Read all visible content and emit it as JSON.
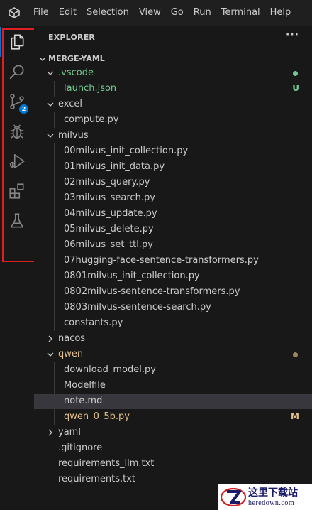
{
  "menu": [
    "File",
    "Edit",
    "Selection",
    "View",
    "Go",
    "Run",
    "Terminal",
    "Help"
  ],
  "activity_bar": {
    "items": [
      {
        "name": "explorer",
        "icon": "files-icon",
        "active": true
      },
      {
        "name": "search",
        "icon": "search-icon"
      },
      {
        "name": "source-control",
        "icon": "source-control-icon",
        "badge": "2"
      },
      {
        "name": "run-debug",
        "icon": "bug-icon"
      },
      {
        "name": "run",
        "icon": "run-debug-icon"
      },
      {
        "name": "extensions",
        "icon": "extensions-icon"
      },
      {
        "name": "testing",
        "icon": "flask-icon"
      }
    ]
  },
  "explorer": {
    "title": "EXPLORER",
    "more": "···",
    "folder": "MERGE-YAML"
  },
  "tree": [
    {
      "label": ".vscode",
      "type": "folder",
      "open": true,
      "depth": 0,
      "color": "green",
      "dot": "#73c991"
    },
    {
      "label": "launch.json",
      "type": "file",
      "depth": 1,
      "color": "green",
      "status": "U"
    },
    {
      "label": "excel",
      "type": "folder",
      "open": true,
      "depth": 0
    },
    {
      "label": "compute.py",
      "type": "file",
      "depth": 1
    },
    {
      "label": "milvus",
      "type": "folder",
      "open": true,
      "depth": 0
    },
    {
      "label": "00milvus_init_collection.py",
      "type": "file",
      "depth": 1
    },
    {
      "label": "01milvus_init_data.py",
      "type": "file",
      "depth": 1
    },
    {
      "label": "02milvus_query.py",
      "type": "file",
      "depth": 1
    },
    {
      "label": "03milvus_search.py",
      "type": "file",
      "depth": 1
    },
    {
      "label": "04milvus_update.py",
      "type": "file",
      "depth": 1
    },
    {
      "label": "05milvus_delete.py",
      "type": "file",
      "depth": 1
    },
    {
      "label": "06milvus_set_ttl.py",
      "type": "file",
      "depth": 1
    },
    {
      "label": "07hugging-face-sentence-transformers.py",
      "type": "file",
      "depth": 1
    },
    {
      "label": "0801milvus_init_collection.py",
      "type": "file",
      "depth": 1
    },
    {
      "label": "0802milvus-sentence-transformers.py",
      "type": "file",
      "depth": 1
    },
    {
      "label": "0803milvus-sentence-search.py",
      "type": "file",
      "depth": 1
    },
    {
      "label": "constants.py",
      "type": "file",
      "depth": 1
    },
    {
      "label": "nacos",
      "type": "folder",
      "open": false,
      "depth": 0
    },
    {
      "label": "qwen",
      "type": "folder",
      "open": true,
      "depth": 0,
      "color": "amber",
      "dot": "#a08660"
    },
    {
      "label": "download_model.py",
      "type": "file",
      "depth": 1
    },
    {
      "label": "Modelfile",
      "type": "file",
      "depth": 1
    },
    {
      "label": "note.md",
      "type": "file",
      "depth": 1,
      "selected": true
    },
    {
      "label": "qwen_0_5b.py",
      "type": "file",
      "depth": 1,
      "color": "amber",
      "status": "M"
    },
    {
      "label": "yaml",
      "type": "folder",
      "open": false,
      "depth": 0
    },
    {
      "label": ".gitignore",
      "type": "file",
      "depth": 0
    },
    {
      "label": "requirements_llm.txt",
      "type": "file",
      "depth": 0
    },
    {
      "label": "requirements.txt",
      "type": "file",
      "depth": 0
    }
  ],
  "colors": {
    "accent": "#0078d4",
    "untracked": "#73c991",
    "modified": "#e2c08d",
    "highlight": "#e02020"
  },
  "watermark": {
    "cn": "这里下载站",
    "en": "heredown.com"
  }
}
